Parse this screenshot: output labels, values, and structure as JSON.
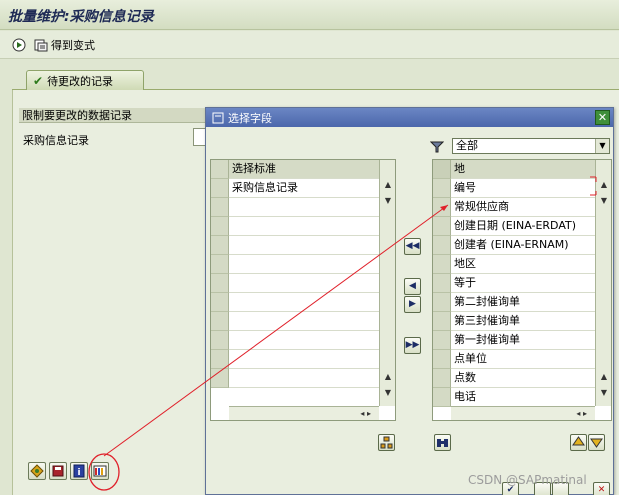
{
  "window": {
    "title": "批量维护:采购信息记录"
  },
  "toolbar": {
    "get_variant_label": "得到变式"
  },
  "tabs": [
    {
      "label": "待更改的记录"
    }
  ],
  "selection": {
    "group_header": "限制要更改的数据记录",
    "field_label": "采购信息记录"
  },
  "dialog": {
    "title": "选择字段",
    "left_table": {
      "header": "选择标准",
      "rows": [
        "采购信息记录",
        "",
        "",
        "",
        "",
        "",
        "",
        "",
        "",
        "",
        "",
        ""
      ]
    },
    "filter_value": "全部",
    "right_table": {
      "rows": [
        "地",
        "编号",
        "常规供应商",
        "创建日期 (EINA-ERDAT)",
        "创建者 (EINA-ERNAM)",
        "地区",
        "等于",
        "第二封催询单",
        "第三封催询单",
        "第一封催询单",
        "点单位",
        "点数",
        "电话"
      ]
    }
  },
  "watermark": "CSDN @SAPmatinal",
  "icons": [
    "execute-icon",
    "get-variant-icon",
    "select-fields-icon",
    "info-icon",
    "filter-icon",
    "close-icon"
  ]
}
